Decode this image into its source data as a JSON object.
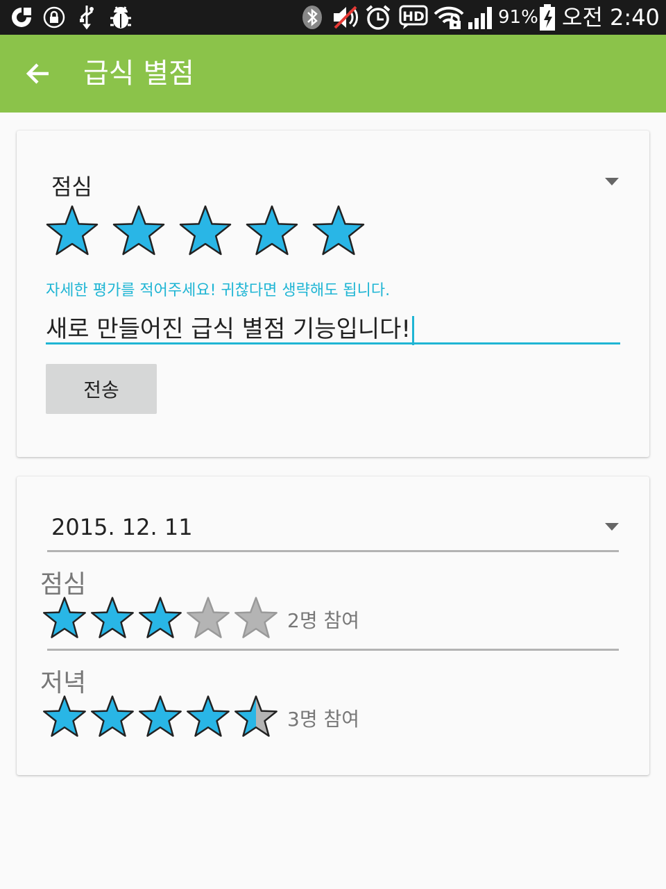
{
  "status_bar": {
    "battery_percent": "91%",
    "time": "오전 2:40",
    "icons": [
      "olleh-icon",
      "lock-icon",
      "usb-icon",
      "debug-icon",
      "bluetooth-icon",
      "mute-icon",
      "alarm-icon",
      "hd-voice-icon",
      "wifi-lock-icon",
      "signal-icon",
      "battery-charging-icon"
    ]
  },
  "app_bar": {
    "title": "급식 별점",
    "back_icon": "arrow-back-icon"
  },
  "rating_form": {
    "meal_selected": "점심",
    "rating": 5,
    "max_rating": 5,
    "comment_hint": "자세한 평가를 적어주세요! 귀찮다면 생략해도 됩니다.",
    "comment_value": "새로 만들어진 급식 별점 기능입니다!",
    "send_label": "전송"
  },
  "results": {
    "date_selected": "2015. 12. 11",
    "meals": [
      {
        "label": "점심",
        "rating": 3,
        "participants": "2명 참여"
      },
      {
        "label": "저녁",
        "rating": 4.5,
        "participants": "3명 참여"
      }
    ]
  },
  "colors": {
    "accent": "#8bc34a",
    "star_filled": "#29b6e6",
    "star_empty": "#b4b4b4",
    "input_accent": "#1fb5d4"
  }
}
